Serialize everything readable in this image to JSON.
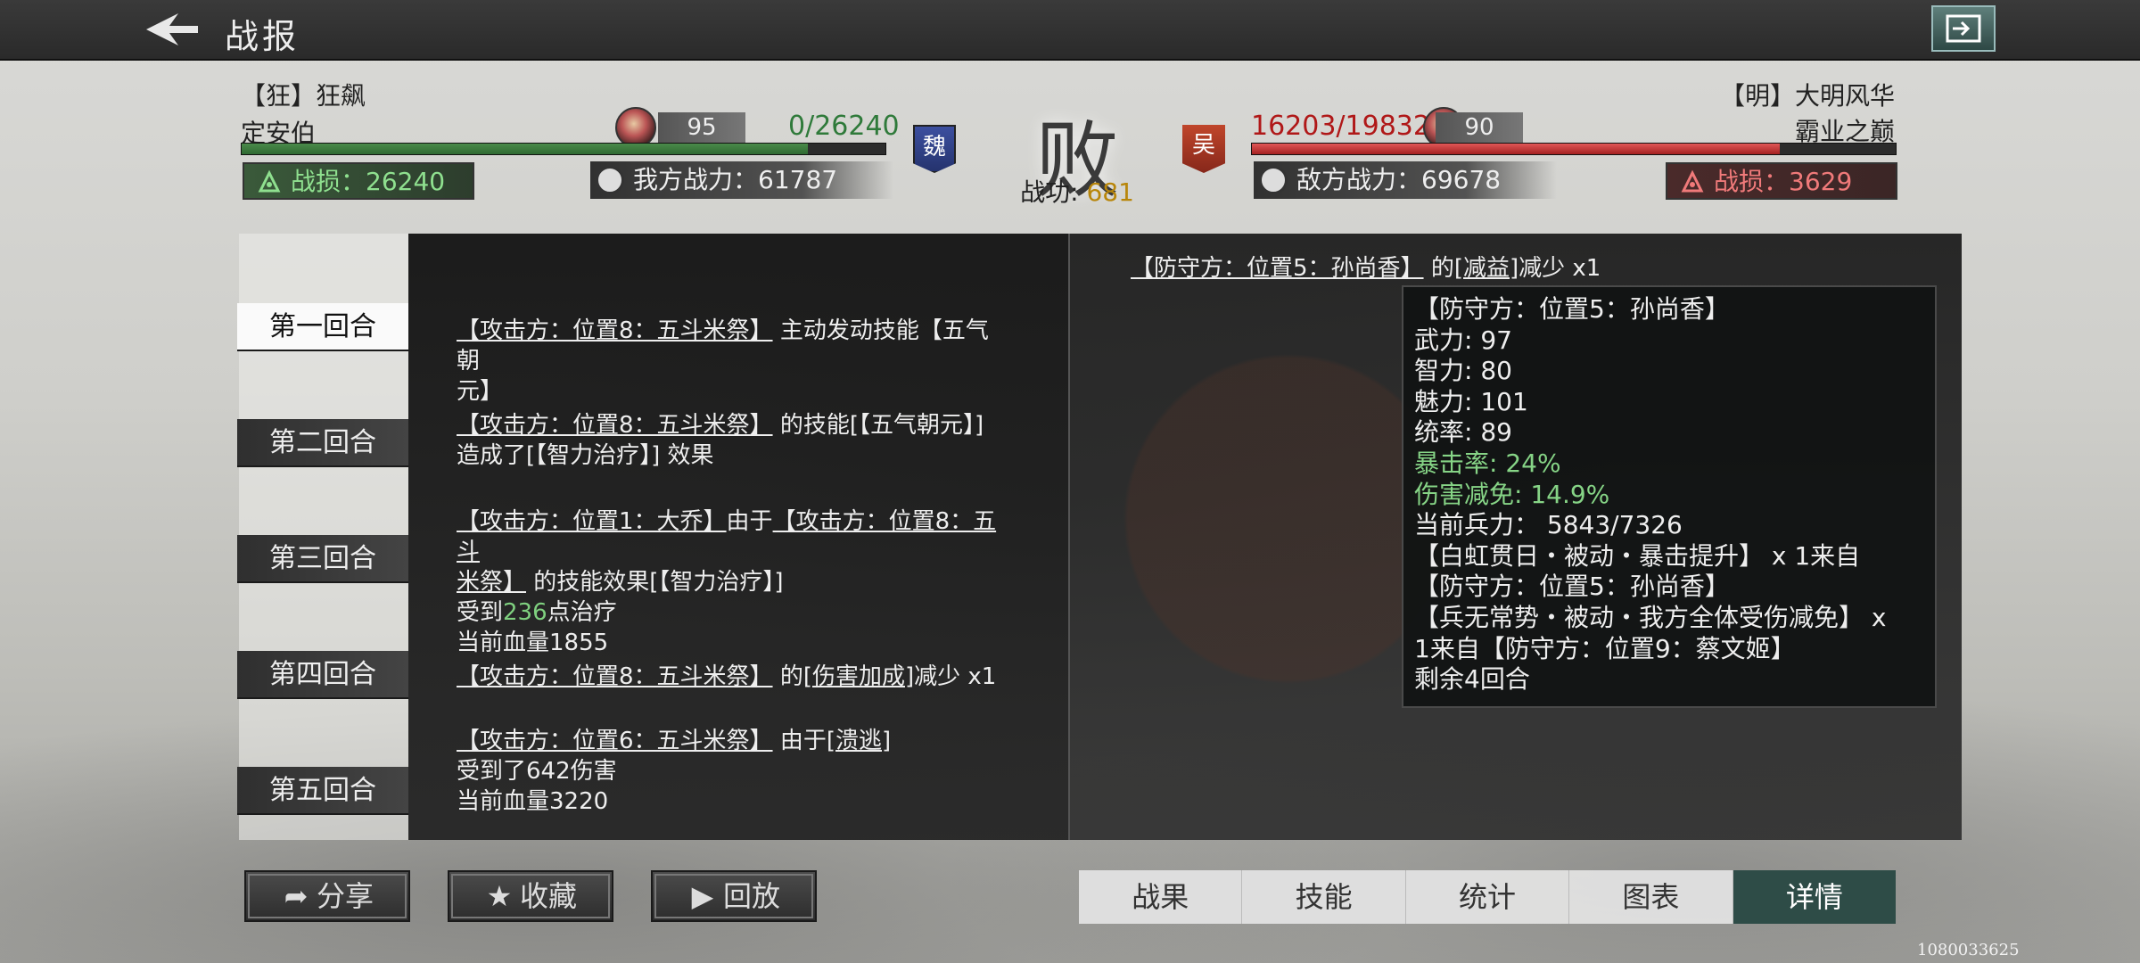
{
  "header": {
    "title": "战报"
  },
  "attacker": {
    "tag": "【狂】狂飙",
    "name": "定安伯",
    "level": "95",
    "troops": "0/26240",
    "troop_fraction": 0.88,
    "faction": "魏",
    "power_label": "我方战力：61787",
    "loss_label": "战损：26240"
  },
  "defender": {
    "tag": "【明】大明风华",
    "name": "霸业之巅",
    "level": "90",
    "troops": "16203/19832",
    "troop_fraction": 0.82,
    "faction": "吴",
    "power_label": "敌方战力：69678",
    "loss_label": "战损：3629"
  },
  "result": {
    "label": "败",
    "merit_prefix": "战功:",
    "merit_value": "681"
  },
  "rounds": [
    "第一回合",
    "第二回合",
    "第三回合",
    "第四回合",
    "第五回合"
  ],
  "log": {
    "e1_a": "【攻击方：位置8：五斗米祭】",
    "e1_b": "主动发动技能【五气朝",
    "e1_c": "元】",
    "e2_a": "【攻击方：位置8：五斗米祭】",
    "e2_b": "的技能[【五气朝元】]",
    "e2_c": "造成了[【智力治疗】] 效果",
    "e3_a": "【攻击方：位置1：大乔】",
    "e3_b": "由于",
    "e3_c": "【攻击方：位置8：五斗",
    "e3_d": "米祭】",
    "e3_e": "的技能效果[【智力治疗】]",
    "e3_f": "受到",
    "e3_g": "236",
    "e3_h": "点治疗",
    "e3_i": "当前血量1855",
    "e4_a": "【攻击方：位置8：五斗米祭】",
    "e4_b": "的",
    "e4_c": "[伤害加成]",
    "e4_d": "减少 x1",
    "e5_a": "【攻击方：位置6：五斗米祭】",
    "e5_b": "由于",
    "e5_c": "[溃逃]",
    "e5_d": "受到了642伤害",
    "e5_e": "当前血量3220"
  },
  "detail": {
    "head_a": "【防守方：位置5：孙尚香】",
    "head_b": "的",
    "head_c": "[减益]",
    "head_d": "减少 x1",
    "tooltip": {
      "l1": "【防守方：位置5：孙尚香】",
      "l2": "武力: 97",
      "l3": "智力: 80",
      "l4": "魅力: 101",
      "l5": "统率: 89",
      "l6": "暴击率: 24%",
      "l7": "伤害减免: 14.9%",
      "l8": "当前兵力： 5843/7326",
      "l9": "【白虹贯日・被动・暴击提升】 x 1来自",
      "l10": "【防守方：位置5：孙尚香】",
      "l11": "【兵无常势・被动・我方全体受伤减免】 x",
      "l12": "1来自【防守方：位置9：蔡文姬】",
      "l13": "剩余4回合"
    }
  },
  "actions": {
    "share": "分享",
    "favorite": "收藏",
    "replay": "回放"
  },
  "tabs": [
    "战果",
    "技能",
    "统计",
    "图表",
    "详情"
  ],
  "corner_id": "1080033625"
}
